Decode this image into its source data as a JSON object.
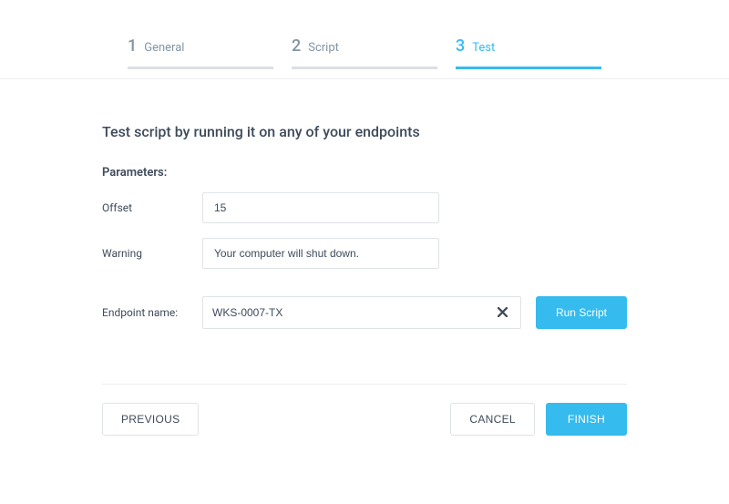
{
  "stepper": {
    "steps": [
      {
        "num": "1",
        "label": "General"
      },
      {
        "num": "2",
        "label": "Script"
      },
      {
        "num": "3",
        "label": "Test"
      }
    ],
    "active_index": 2
  },
  "page_title": "Test script by running it on any of your endpoints",
  "parameters_heading": "Parameters:",
  "parameters": [
    {
      "name": "Offset",
      "value": "15"
    },
    {
      "name": "Warning",
      "value": "Your computer will shut down."
    }
  ],
  "endpoint": {
    "label": "Endpoint name:",
    "value": "WKS-0007-TX"
  },
  "buttons": {
    "run_script": "Run Script",
    "previous": "PREVIOUS",
    "cancel": "CANCEL",
    "finish": "FINISH"
  }
}
